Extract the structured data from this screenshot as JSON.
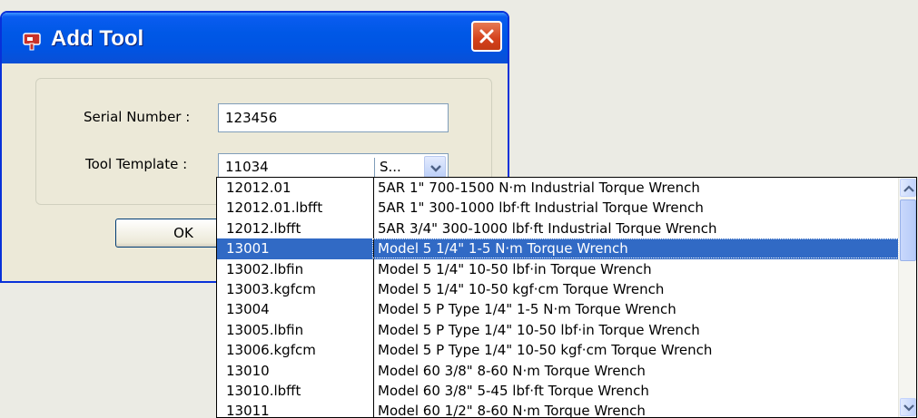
{
  "dialog": {
    "title": "Add Tool",
    "icon": "app-icon",
    "close_icon": "close-icon"
  },
  "form": {
    "serial_label": "Serial Number :",
    "serial_value": "123456",
    "template_label": "Tool Template :",
    "template_code": "11034",
    "template_desc": "S...",
    "ok_label": "OK"
  },
  "dropdown": {
    "selected_index": 3,
    "items": [
      {
        "code": "12012.01",
        "desc": "5AR 1\" 700-1500 N·m Industrial Torque Wrench"
      },
      {
        "code": "12012.01.lbfft",
        "desc": "5AR 1\" 300-1000 lbf·ft Industrial Torque Wrench"
      },
      {
        "code": "12012.lbfft",
        "desc": "5AR 3/4\" 300-1000 lbf·ft Industrial Torque Wrench"
      },
      {
        "code": "13001",
        "desc": "Model 5 1/4\" 1-5 N·m Torque Wrench"
      },
      {
        "code": "13002.lbfin",
        "desc": "Model 5 1/4\" 10-50 lbf·in Torque Wrench"
      },
      {
        "code": "13003.kgfcm",
        "desc": "Model 5 1/4\" 10-50 kgf·cm Torque Wrench"
      },
      {
        "code": "13004",
        "desc": "Model 5 P Type 1/4\" 1-5 N·m Torque Wrench"
      },
      {
        "code": "13005.lbfin",
        "desc": "Model 5 P Type 1/4\" 10-50 lbf·in Torque Wrench"
      },
      {
        "code": "13006.kgfcm",
        "desc": "Model 5 P Type 1/4\" 10-50 kgf·cm Torque Wrench"
      },
      {
        "code": "13010",
        "desc": "Model 60 3/8\" 8-60 N·m Torque Wrench"
      },
      {
        "code": "13010.lbfft",
        "desc": "Model 60 3/8\" 5-45 lbf·ft Torque Wrench"
      },
      {
        "code": "13011",
        "desc": "Model 60 1/2\" 8-60 N·m Torque Wrench"
      }
    ]
  },
  "colors": {
    "titlebar": "#0054e3",
    "selection": "#316ac5",
    "close": "#d4411c"
  }
}
